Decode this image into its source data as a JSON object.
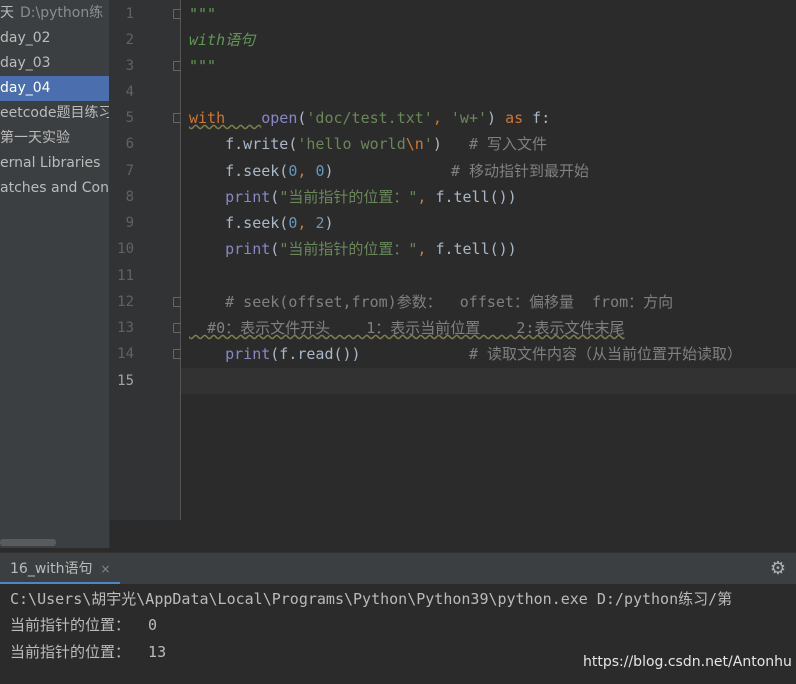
{
  "project_tree": {
    "root_label": "天",
    "root_path": "D:\\python练",
    "items": [
      {
        "label": "day_02"
      },
      {
        "label": "day_03"
      },
      {
        "label": "day_04"
      },
      {
        "label": "eetcode题目练习"
      },
      {
        "label": "第一天实验"
      },
      {
        "label": "ernal Libraries"
      },
      {
        "label": "atches and Cons"
      }
    ]
  },
  "editor": {
    "line_numbers": [
      "1",
      "2",
      "3",
      "4",
      "5",
      "6",
      "7",
      "8",
      "9",
      "10",
      "11",
      "12",
      "13",
      "14",
      "15"
    ],
    "current_line": "15"
  },
  "run_window": {
    "tab_label": "16_with语句",
    "close_glyph": "×",
    "settings_icon": "gear-icon",
    "console_lines": [
      "C:\\Users\\胡宇光\\AppData\\Local\\Programs\\Python\\Python39\\python.exe D:/python练习/第",
      "当前指针的位置：  0",
      "当前指针的位置：  13"
    ]
  },
  "watermark": "https://blog.csdn.net/Antonhu",
  "colors": {
    "background": "#2b2b2b",
    "sidebar": "#3c3f41",
    "selection": "#4b6eaf",
    "keyword": "#cc7832",
    "string": "#6a8759",
    "number": "#6897bb",
    "comment": "#808080",
    "builtin": "#8888c6"
  }
}
